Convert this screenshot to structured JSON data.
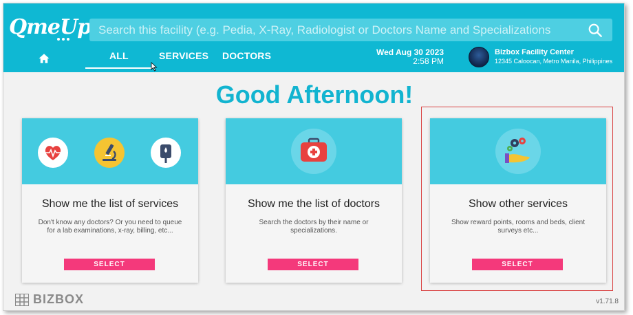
{
  "app": {
    "logo_text": "QmeUp"
  },
  "search": {
    "placeholder": "Search this facility (e.g. Pedia, X-Ray, Radiologist or Doctors Name and Specializations"
  },
  "nav": {
    "tabs": [
      {
        "label": "ALL",
        "active": true
      },
      {
        "label": "SERVICES",
        "active": false
      },
      {
        "label": "DOCTORS",
        "active": false
      }
    ]
  },
  "header": {
    "date": "Wed Aug 30 2023",
    "time": "2:58 PM",
    "facility_name": "Bizbox Facility Center",
    "facility_address": "12345 Caloocan, Metro Manila, Philippines"
  },
  "greeting": "Good Afternoon!",
  "cards": [
    {
      "title": "Show me the list of services",
      "description": "Don't know any doctors? Or you need to queue for a lab examinations, x-ray, billing, etc...",
      "button": "SELECT",
      "icons": [
        "heart-monitor-icon",
        "microscope-icon",
        "iv-drip-icon"
      ]
    },
    {
      "title": "Show me the list of doctors",
      "description": "Search the doctors by their name or specializations.",
      "button": "SELECT",
      "icons": [
        "medical-kit-icon"
      ]
    },
    {
      "title": "Show other services",
      "description": "Show reward points, rooms and beds, client surveys etc...",
      "button": "SELECT",
      "icons": [
        "gears-hand-icon"
      ]
    }
  ],
  "footer": {
    "brand": "BIZBOX",
    "version": "v1.71.8"
  },
  "colors": {
    "header": "#0fb8d3",
    "card_top": "#44cbe0",
    "button": "#f4397b",
    "greeting": "#12b4d0",
    "highlight": "#d94141"
  }
}
